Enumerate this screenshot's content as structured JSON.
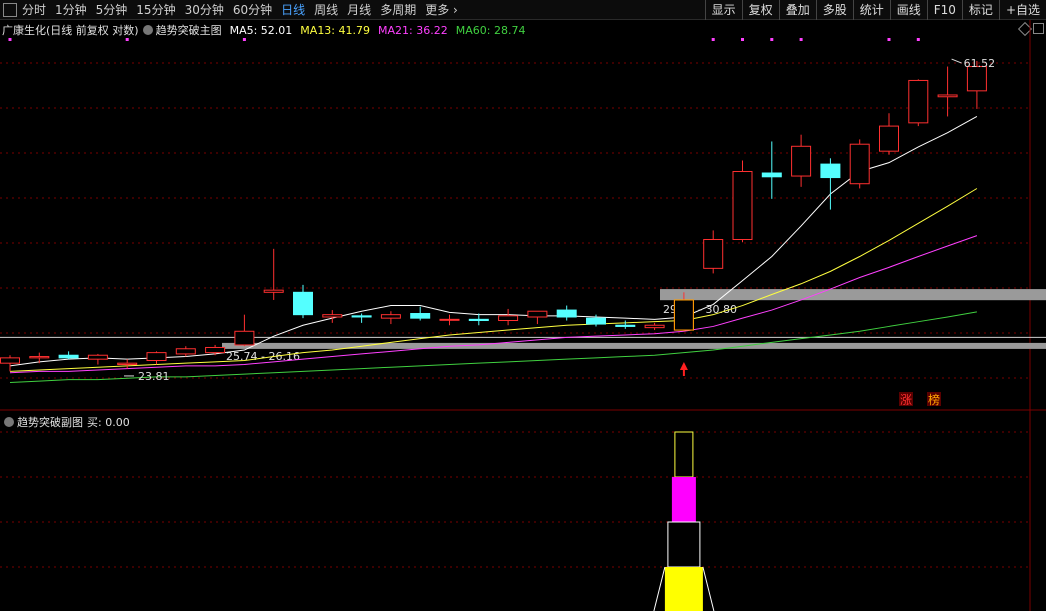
{
  "toolbar": {
    "periods": [
      "分时",
      "1分钟",
      "5分钟",
      "15分钟",
      "30分钟",
      "60分钟",
      "日线",
      "周线",
      "月线",
      "多周期",
      "更多"
    ],
    "active_period": "日线",
    "right_buttons": [
      "显示",
      "复权",
      "叠加",
      "多股",
      "统计",
      "画线",
      "F10",
      "标记",
      "+自选"
    ]
  },
  "main_legend": {
    "stock_info": "广康生化(日线 前复权 对数)",
    "indicator": "趋势突破主图",
    "ma5": "MA5: 52.01",
    "ma13": "MA13: 41.79",
    "ma21": "MA21: 36.22",
    "ma60": "MA60: 28.74"
  },
  "sub_legend": {
    "indicator": "趋势突破副图",
    "value": "买: 0.00"
  },
  "colors": {
    "up": "#ff3030",
    "down": "#54ffff",
    "ma5": "#ffffff",
    "ma13": "#ffff40",
    "ma21": "#ff40ff",
    "ma60": "#40d040",
    "grid": "#7a0000",
    "zone": "#9a9a9a"
  },
  "chart_data": {
    "type": "candlestick",
    "ylim": [
      22,
      64
    ],
    "candles": [
      {
        "o": 24.6,
        "h": 25.2,
        "l": 24.0,
        "c": 25.0
      },
      {
        "o": 25.0,
        "h": 25.4,
        "l": 24.6,
        "c": 25.1
      },
      {
        "o": 25.2,
        "h": 25.5,
        "l": 24.9,
        "c": 25.0
      },
      {
        "o": 24.9,
        "h": 25.3,
        "l": 24.5,
        "c": 25.2
      },
      {
        "o": 24.5,
        "h": 24.9,
        "l": 24.2,
        "c": 24.6
      },
      {
        "o": 24.8,
        "h": 25.5,
        "l": 24.5,
        "c": 25.4
      },
      {
        "o": 25.3,
        "h": 25.9,
        "l": 25.1,
        "c": 25.7
      },
      {
        "o": 25.4,
        "h": 26.0,
        "l": 25.2,
        "c": 25.8
      },
      {
        "o": 26.0,
        "h": 28.5,
        "l": 25.9,
        "c": 27.1
      },
      {
        "o": 30.5,
        "h": 34.8,
        "l": 29.8,
        "c": 30.7
      },
      {
        "o": 30.5,
        "h": 31.2,
        "l": 28.2,
        "c": 28.5
      },
      {
        "o": 28.3,
        "h": 28.9,
        "l": 27.8,
        "c": 28.5
      },
      {
        "o": 28.4,
        "h": 28.6,
        "l": 27.8,
        "c": 28.3
      },
      {
        "o": 28.2,
        "h": 28.8,
        "l": 27.7,
        "c": 28.5
      },
      {
        "o": 28.6,
        "h": 29.2,
        "l": 28.0,
        "c": 28.2
      },
      {
        "o": 28.1,
        "h": 28.5,
        "l": 27.6,
        "c": 28.1
      },
      {
        "o": 28.1,
        "h": 28.6,
        "l": 27.6,
        "c": 28.0
      },
      {
        "o": 28.0,
        "h": 29.0,
        "l": 27.6,
        "c": 28.4
      },
      {
        "o": 28.3,
        "h": 28.8,
        "l": 27.7,
        "c": 28.8
      },
      {
        "o": 28.9,
        "h": 29.3,
        "l": 28.0,
        "c": 28.3
      },
      {
        "o": 28.2,
        "h": 28.5,
        "l": 27.5,
        "c": 27.7
      },
      {
        "o": 27.6,
        "h": 28.0,
        "l": 27.3,
        "c": 27.5
      },
      {
        "o": 27.4,
        "h": 27.8,
        "l": 27.2,
        "c": 27.6
      },
      {
        "o": 27.2,
        "h": 30.5,
        "l": 27.1,
        "c": 29.8
      },
      {
        "o": 32.8,
        "h": 36.8,
        "l": 32.3,
        "c": 35.8
      },
      {
        "o": 35.8,
        "h": 45.5,
        "l": 35.5,
        "c": 44.0
      },
      {
        "o": 43.8,
        "h": 48.2,
        "l": 40.5,
        "c": 43.3
      },
      {
        "o": 43.4,
        "h": 49.2,
        "l": 42.0,
        "c": 47.5
      },
      {
        "o": 45.0,
        "h": 45.8,
        "l": 39.2,
        "c": 43.2
      },
      {
        "o": 42.4,
        "h": 48.5,
        "l": 41.8,
        "c": 47.8
      },
      {
        "o": 46.8,
        "h": 52.5,
        "l": 46.3,
        "c": 50.5
      },
      {
        "o": 51.0,
        "h": 58.2,
        "l": 50.5,
        "c": 58.0
      },
      {
        "o": 55.2,
        "h": 60.5,
        "l": 52.0,
        "c": 55.5
      },
      {
        "o": 56.2,
        "h": 61.52,
        "l": 53.2,
        "c": 60.5
      }
    ],
    "ma5": [
      24.4,
      24.7,
      24.9,
      25.0,
      24.9,
      25.0,
      25.1,
      25.3,
      25.6,
      26.7,
      27.6,
      28.2,
      28.8,
      29.3,
      29.3,
      28.7,
      28.5,
      28.5,
      28.4,
      28.4,
      28.3,
      28.2,
      28.1,
      28.3,
      29.4,
      31.6,
      34.0,
      37.3,
      41.1,
      44.0,
      45.2,
      47.4,
      49.5,
      52.01
    ],
    "ma13": [
      24.0,
      24.1,
      24.2,
      24.3,
      24.4,
      24.5,
      24.6,
      24.7,
      24.8,
      25.1,
      25.4,
      25.6,
      25.9,
      26.2,
      26.5,
      26.8,
      27.0,
      27.2,
      27.4,
      27.6,
      27.7,
      27.8,
      27.9,
      28.0,
      28.5,
      29.3,
      30.3,
      31.3,
      32.5,
      34.0,
      35.7,
      37.6,
      39.6,
      41.79
    ],
    "ma21": [
      23.9,
      24.0,
      24.0,
      24.1,
      24.2,
      24.3,
      24.4,
      24.4,
      24.5,
      24.7,
      24.9,
      25.1,
      25.3,
      25.5,
      25.7,
      25.9,
      26.0,
      26.2,
      26.4,
      26.6,
      26.7,
      26.8,
      26.9,
      27.1,
      27.5,
      28.2,
      28.9,
      29.8,
      30.8,
      31.9,
      32.9,
      34.0,
      35.1,
      36.22
    ],
    "ma60": [
      23.2,
      23.3,
      23.4,
      23.4,
      23.5,
      23.6,
      23.6,
      23.7,
      23.8,
      23.9,
      24.0,
      24.1,
      24.2,
      24.3,
      24.4,
      24.5,
      24.6,
      24.7,
      24.8,
      24.9,
      25.0,
      25.1,
      25.2,
      25.4,
      25.6,
      25.9,
      26.2,
      26.5,
      26.8,
      27.1,
      27.5,
      27.9,
      28.3,
      28.74
    ],
    "zones": [
      {
        "label": "29.78 - 30.80",
        "low": 29.78,
        "high": 30.8
      },
      {
        "label": "25.74 - 26.16",
        "low": 25.74,
        "high": 26.16
      }
    ],
    "h_line": 26.6,
    "low_marker": "23.81",
    "high_marker": "61.52",
    "low_marker_value": 23.81,
    "high_marker_value": 61.52,
    "signal_dot_indices": [
      0,
      4,
      8,
      24,
      25,
      26,
      27,
      30,
      31
    ],
    "buy_arrow_index": 23,
    "tag_up": "涨",
    "tag_upper": "榜",
    "tag_index": 30
  }
}
